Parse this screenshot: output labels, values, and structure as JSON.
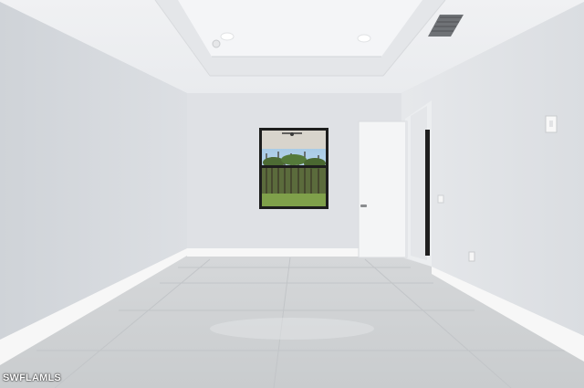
{
  "watermark": {
    "text": "SWFLAMLS"
  },
  "colors": {
    "wall_left": "#d6d9dd",
    "wall_back": "#dfe1e5",
    "wall_right": "#e3e5e9",
    "ceiling": "#eef0f2",
    "floor": "#cfd2d5",
    "trim": "#f7f7f7",
    "door": "#f4f5f6",
    "window_frame": "#1d1d1d"
  },
  "icons": [
    "recessed-light-icon",
    "smoke-detector-icon",
    "ac-vent-icon",
    "light-switch-icon",
    "outlet-icon",
    "door-handle-icon"
  ]
}
